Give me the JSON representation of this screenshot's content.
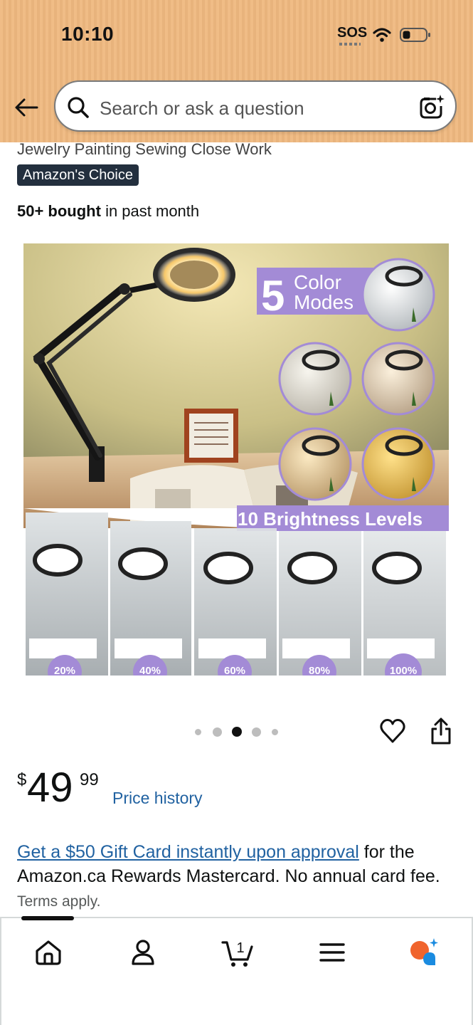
{
  "status_bar": {
    "time": "10:10",
    "sos": "SOS"
  },
  "search": {
    "placeholder": "Search or ask a question"
  },
  "product": {
    "title_tail": "Jewelry Painting Sewing Close Work",
    "badge": "Amazon's Choice",
    "bought_bold": "50+ bought",
    "bought_rest": " in past month",
    "image_text": {
      "color_modes_number": "5",
      "color_modes_line1": "Color",
      "color_modes_line2": "Modes",
      "brightness": "10 Brightness Levels",
      "levels": [
        "20%",
        "40%",
        "60%",
        "80%",
        "100%"
      ]
    },
    "carousel": {
      "total": 5,
      "active_index": 2
    },
    "price": {
      "currency": "$",
      "whole": "49",
      "fraction": "99"
    },
    "price_history_label": "Price history",
    "promo": {
      "link": "Get a $50 Gift Card instantly upon approval",
      "text": " for the Amazon.ca Rewards Mastercard. No annual card fee. ",
      "terms": "Terms apply."
    }
  },
  "nav": {
    "cart_count": "1",
    "items": [
      "home-icon",
      "account-icon",
      "cart-icon",
      "menu-icon",
      "rufus-ai-icon"
    ]
  },
  "colors": {
    "header_bg": "#efb980",
    "link": "#2162a1",
    "badge_bg": "#232f3e",
    "accent_orange": "#f0642d",
    "accent_blue": "#1a8be0",
    "promo_purple": "#a38bd6"
  }
}
